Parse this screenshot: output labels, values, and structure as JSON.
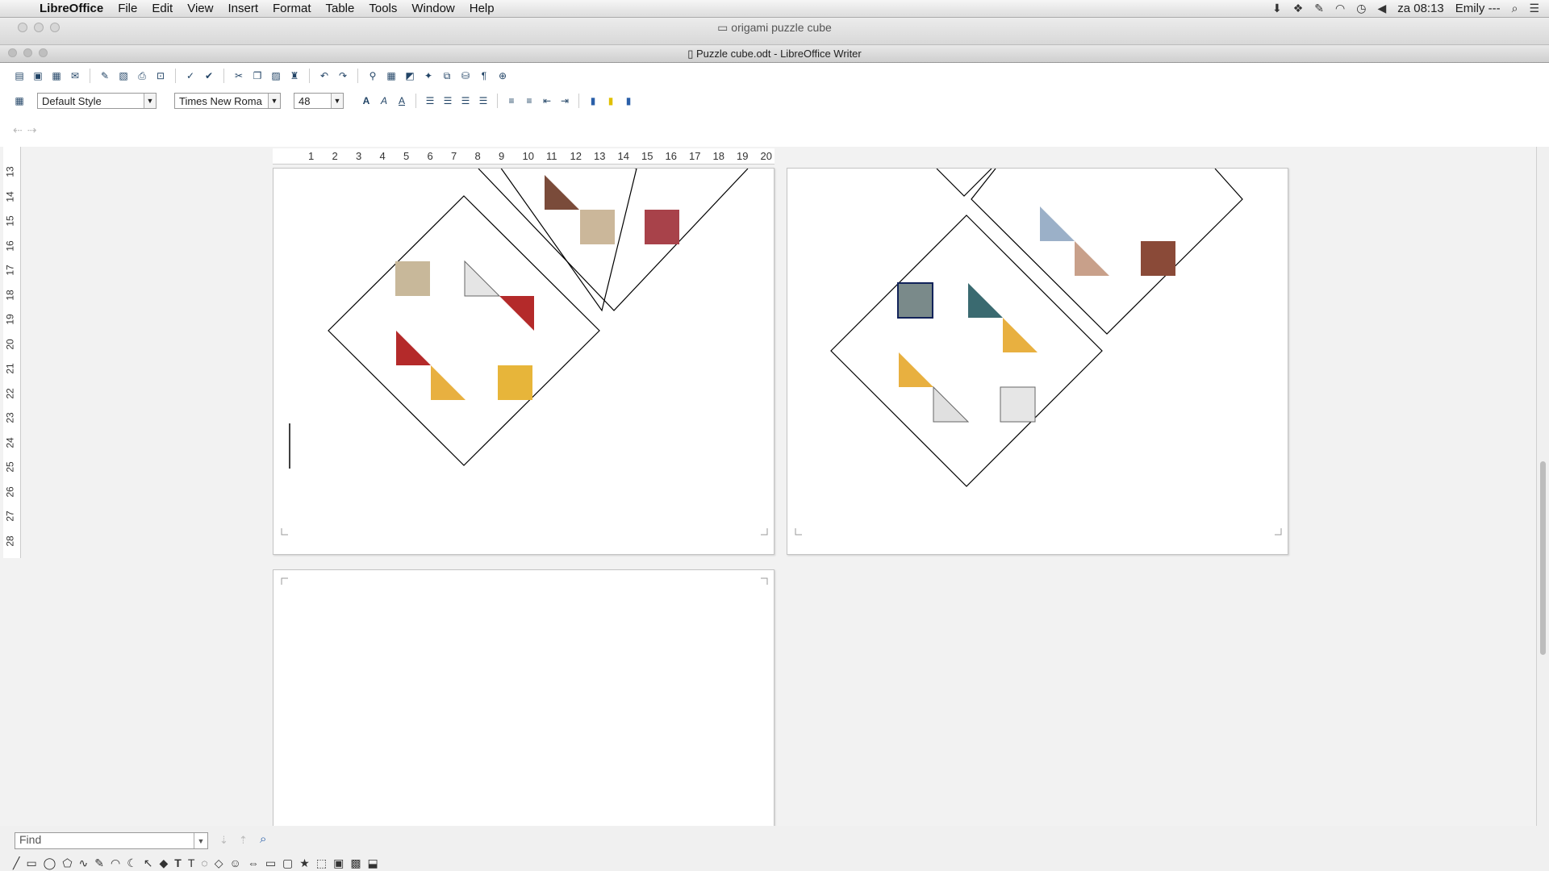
{
  "menubar": {
    "apple": "",
    "app_name": "LibreOffice",
    "menus": [
      "File",
      "Edit",
      "View",
      "Insert",
      "Format",
      "Table",
      "Tools",
      "Window",
      "Help"
    ],
    "clock": "za 08:13",
    "user": "Emily ---"
  },
  "finder": {
    "title": "origami puzzle cube"
  },
  "writer": {
    "title": "Puzzle cube.odt - LibreOffice Writer"
  },
  "formatting": {
    "paragraph_style": "Default Style",
    "font_name": "Times New Roma",
    "font_size": "48"
  },
  "ruler": {
    "horizontal": [
      "1",
      "2",
      "3",
      "4",
      "5",
      "6",
      "7",
      "8",
      "9",
      "10",
      "11",
      "12",
      "13",
      "14",
      "15",
      "16",
      "17",
      "18",
      "19",
      "20"
    ],
    "vertical": [
      "13",
      "14",
      "15",
      "16",
      "17",
      "18",
      "19",
      "20",
      "21",
      "22",
      "23",
      "24",
      "25",
      "26",
      "27",
      "28"
    ]
  },
  "find": {
    "placeholder": "Find"
  },
  "colors": {
    "accent": "#2a5fa8",
    "page": "#ffffff",
    "background": "#f2f2f2"
  }
}
